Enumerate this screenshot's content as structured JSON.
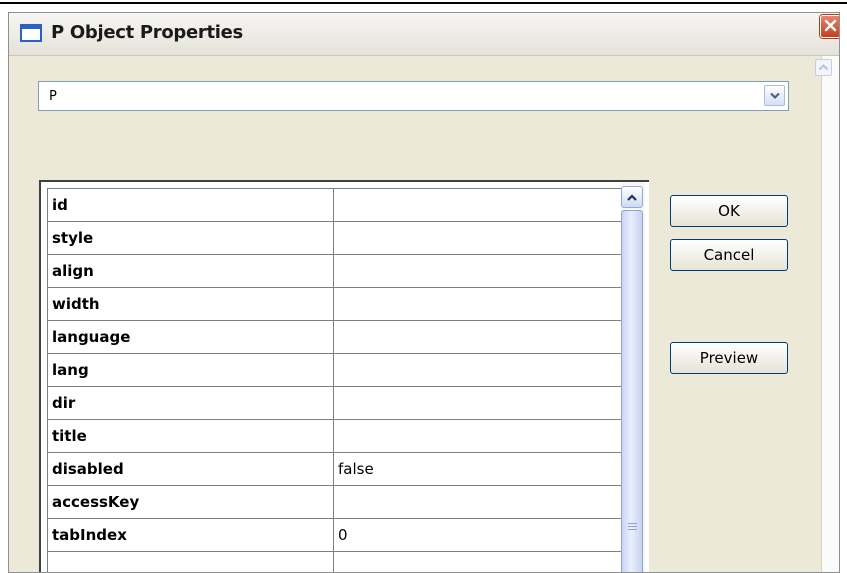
{
  "window": {
    "title": "P Object Properties"
  },
  "selector": {
    "value": "P"
  },
  "properties": [
    {
      "name": "id",
      "value": ""
    },
    {
      "name": "style",
      "value": ""
    },
    {
      "name": "align",
      "value": ""
    },
    {
      "name": "width",
      "value": ""
    },
    {
      "name": "language",
      "value": ""
    },
    {
      "name": "lang",
      "value": ""
    },
    {
      "name": "dir",
      "value": ""
    },
    {
      "name": "title",
      "value": ""
    },
    {
      "name": "disabled",
      "value": "false"
    },
    {
      "name": "accessKey",
      "value": ""
    },
    {
      "name": "tabIndex",
      "value": "0"
    },
    {
      "name": "",
      "value": ""
    }
  ],
  "buttons": {
    "ok": "OK",
    "cancel": "Cancel",
    "preview": "Preview"
  },
  "icons": {
    "window": "window-icon",
    "close": "close-icon",
    "dropdown": "chevron-down-icon",
    "scroll_up": "chevron-up-icon"
  },
  "colors": {
    "close_button": "#c1411e",
    "dialog_bg": "#ece9d8",
    "field_border": "#7f9db9"
  }
}
